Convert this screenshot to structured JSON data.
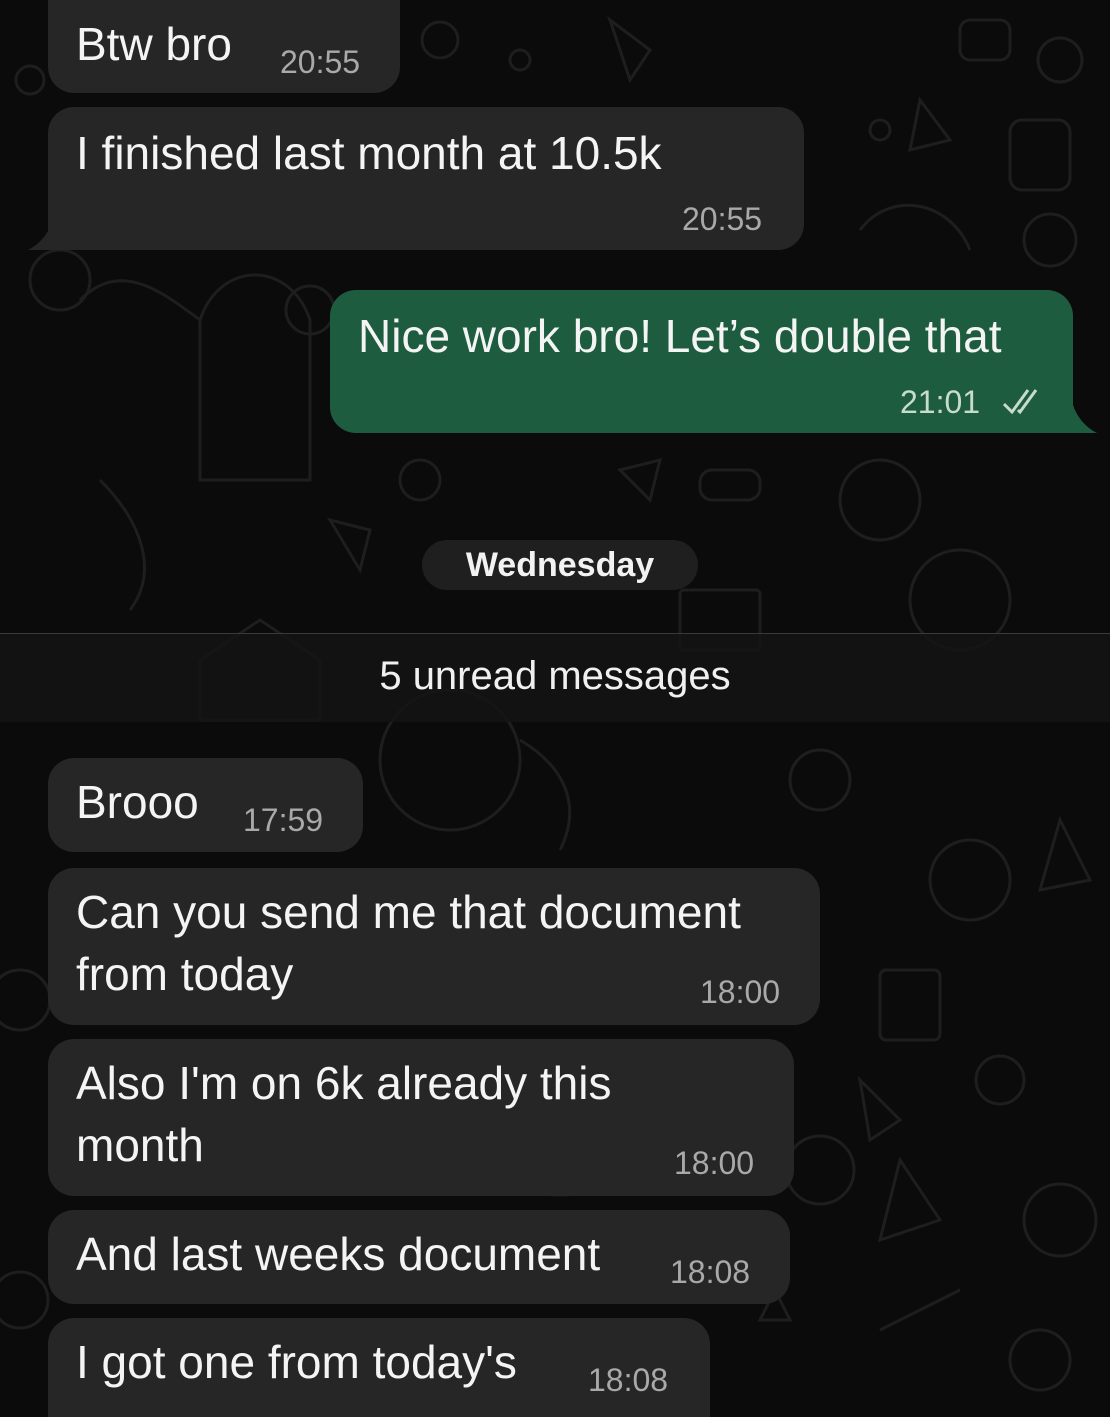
{
  "messages": [
    {
      "id": "m1",
      "direction": "incoming",
      "text": "Btw bro",
      "time": "20:55"
    },
    {
      "id": "m2",
      "direction": "incoming",
      "text": "I finished last month at 10.5k",
      "time": "20:55"
    },
    {
      "id": "m3",
      "direction": "outgoing",
      "text": "Nice work bro! Let’s double that",
      "time": "21:01",
      "status": "read"
    },
    {
      "id": "m4",
      "direction": "incoming",
      "text": "Brooo",
      "time": "17:59"
    },
    {
      "id": "m5",
      "direction": "incoming",
      "lines": [
        "Can you send me that document",
        "from today"
      ],
      "time": "18:00"
    },
    {
      "id": "m6",
      "direction": "incoming",
      "lines": [
        "Also I'm on 6k already this",
        "month"
      ],
      "time": "18:00"
    },
    {
      "id": "m7",
      "direction": "incoming",
      "text": "And last weeks document",
      "time": "18:08"
    },
    {
      "id": "m8",
      "direction": "incoming",
      "text": "I got one from today's",
      "time": "18:08"
    }
  ],
  "date_separator": "Wednesday",
  "unread_banner": "5 unread messages",
  "colors": {
    "background": "#0b0b0b",
    "incoming_bubble": "#262626",
    "outgoing_bubble": "#1e5c3f",
    "timestamp": "#a9a9a9",
    "read_ticks": "#c7dccf"
  },
  "icons": {
    "read_receipt": "double-check-icon"
  }
}
